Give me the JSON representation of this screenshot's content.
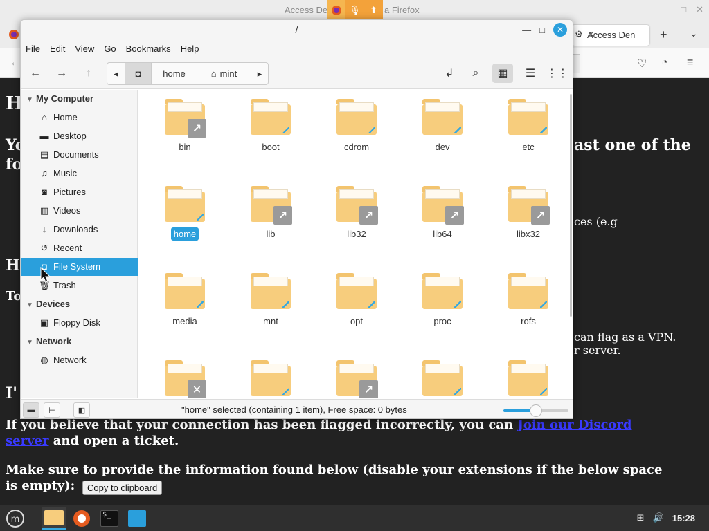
{
  "firefox": {
    "title_left": "Access De",
    "title_right": "a Firefox",
    "tab_label": "Access Den",
    "tab_close": "✕",
    "new_tab": "+",
    "tab_list": "⌄",
    "win_min": "—",
    "win_max": "□",
    "win_close": "✕",
    "page": {
      "frag_h1": "H",
      "frag_yo": "Yo",
      "frag_fo": "fo",
      "frag_last": "ast one of the",
      "frag_ces": "ces (e.g",
      "frag_h2": "H",
      "frag_to": "To",
      "frag_vpn": "can flag as a VPN.",
      "frag_server": "r server.",
      "frag_i": "I'",
      "line1_pre": "If you believe that your connection has been flagged incorrectly, you can ",
      "link1": "Join our Discord",
      "link2": "server",
      "line2_post": " and open a ticket.",
      "line3": "Make sure to provide the information found below (disable your extensions if the below space",
      "line4_pre": "is empty):",
      "copy_button": "Copy to clipboard"
    }
  },
  "nemo": {
    "title": "/",
    "menu": [
      "File",
      "Edit",
      "View",
      "Go",
      "Bookmarks",
      "Help"
    ],
    "path": [
      "home",
      "mint"
    ],
    "sidebar": {
      "sections": [
        {
          "name": "My Computer"
        },
        {
          "name": "Devices"
        },
        {
          "name": "Network"
        }
      ],
      "items": [
        {
          "label": "Home",
          "icon": "home-icon",
          "glyph": "⌂"
        },
        {
          "label": "Desktop",
          "icon": "desktop-icon",
          "glyph": "▬"
        },
        {
          "label": "Documents",
          "icon": "documents-icon",
          "glyph": "▤"
        },
        {
          "label": "Music",
          "icon": "music-icon",
          "glyph": "♫"
        },
        {
          "label": "Pictures",
          "icon": "pictures-icon",
          "glyph": "◙"
        },
        {
          "label": "Videos",
          "icon": "videos-icon",
          "glyph": "▥"
        },
        {
          "label": "Downloads",
          "icon": "downloads-icon",
          "glyph": "↓"
        },
        {
          "label": "Recent",
          "icon": "recent-icon",
          "glyph": "↺"
        },
        {
          "label": "File System",
          "icon": "drive-icon",
          "glyph": "◘"
        },
        {
          "label": "Trash",
          "icon": "trash-icon",
          "glyph": "🗑"
        },
        {
          "label": "Floppy Disk",
          "icon": "floppy-icon",
          "glyph": "▣"
        },
        {
          "label": "Network",
          "icon": "network-icon",
          "glyph": "◍"
        }
      ]
    },
    "folders": [
      {
        "name": "bin",
        "emblem": "↗"
      },
      {
        "name": "boot",
        "emblem": ""
      },
      {
        "name": "cdrom",
        "emblem": ""
      },
      {
        "name": "dev",
        "emblem": ""
      },
      {
        "name": "etc",
        "emblem": ""
      },
      {
        "name": "home",
        "emblem": ""
      },
      {
        "name": "lib",
        "emblem": "↗"
      },
      {
        "name": "lib32",
        "emblem": "↗"
      },
      {
        "name": "lib64",
        "emblem": "↗"
      },
      {
        "name": "libx32",
        "emblem": "↗"
      },
      {
        "name": "media",
        "emblem": ""
      },
      {
        "name": "mnt",
        "emblem": ""
      },
      {
        "name": "opt",
        "emblem": ""
      },
      {
        "name": "proc",
        "emblem": ""
      },
      {
        "name": "rofs",
        "emblem": ""
      },
      {
        "name": "",
        "emblem": "✕"
      },
      {
        "name": "",
        "emblem": ""
      },
      {
        "name": "",
        "emblem": "↗"
      },
      {
        "name": "",
        "emblem": ""
      },
      {
        "name": "",
        "emblem": ""
      }
    ],
    "selected_folder": "home",
    "status_text": "\"home\" selected (containing 1 item), Free space: 0 bytes",
    "zoom_level": 0.5
  },
  "taskbar": {
    "clock": "15:28"
  },
  "colors": {
    "accent": "#2a9fdc",
    "folder": "#f7cd7d",
    "rec_orange": "#f3a23a"
  }
}
